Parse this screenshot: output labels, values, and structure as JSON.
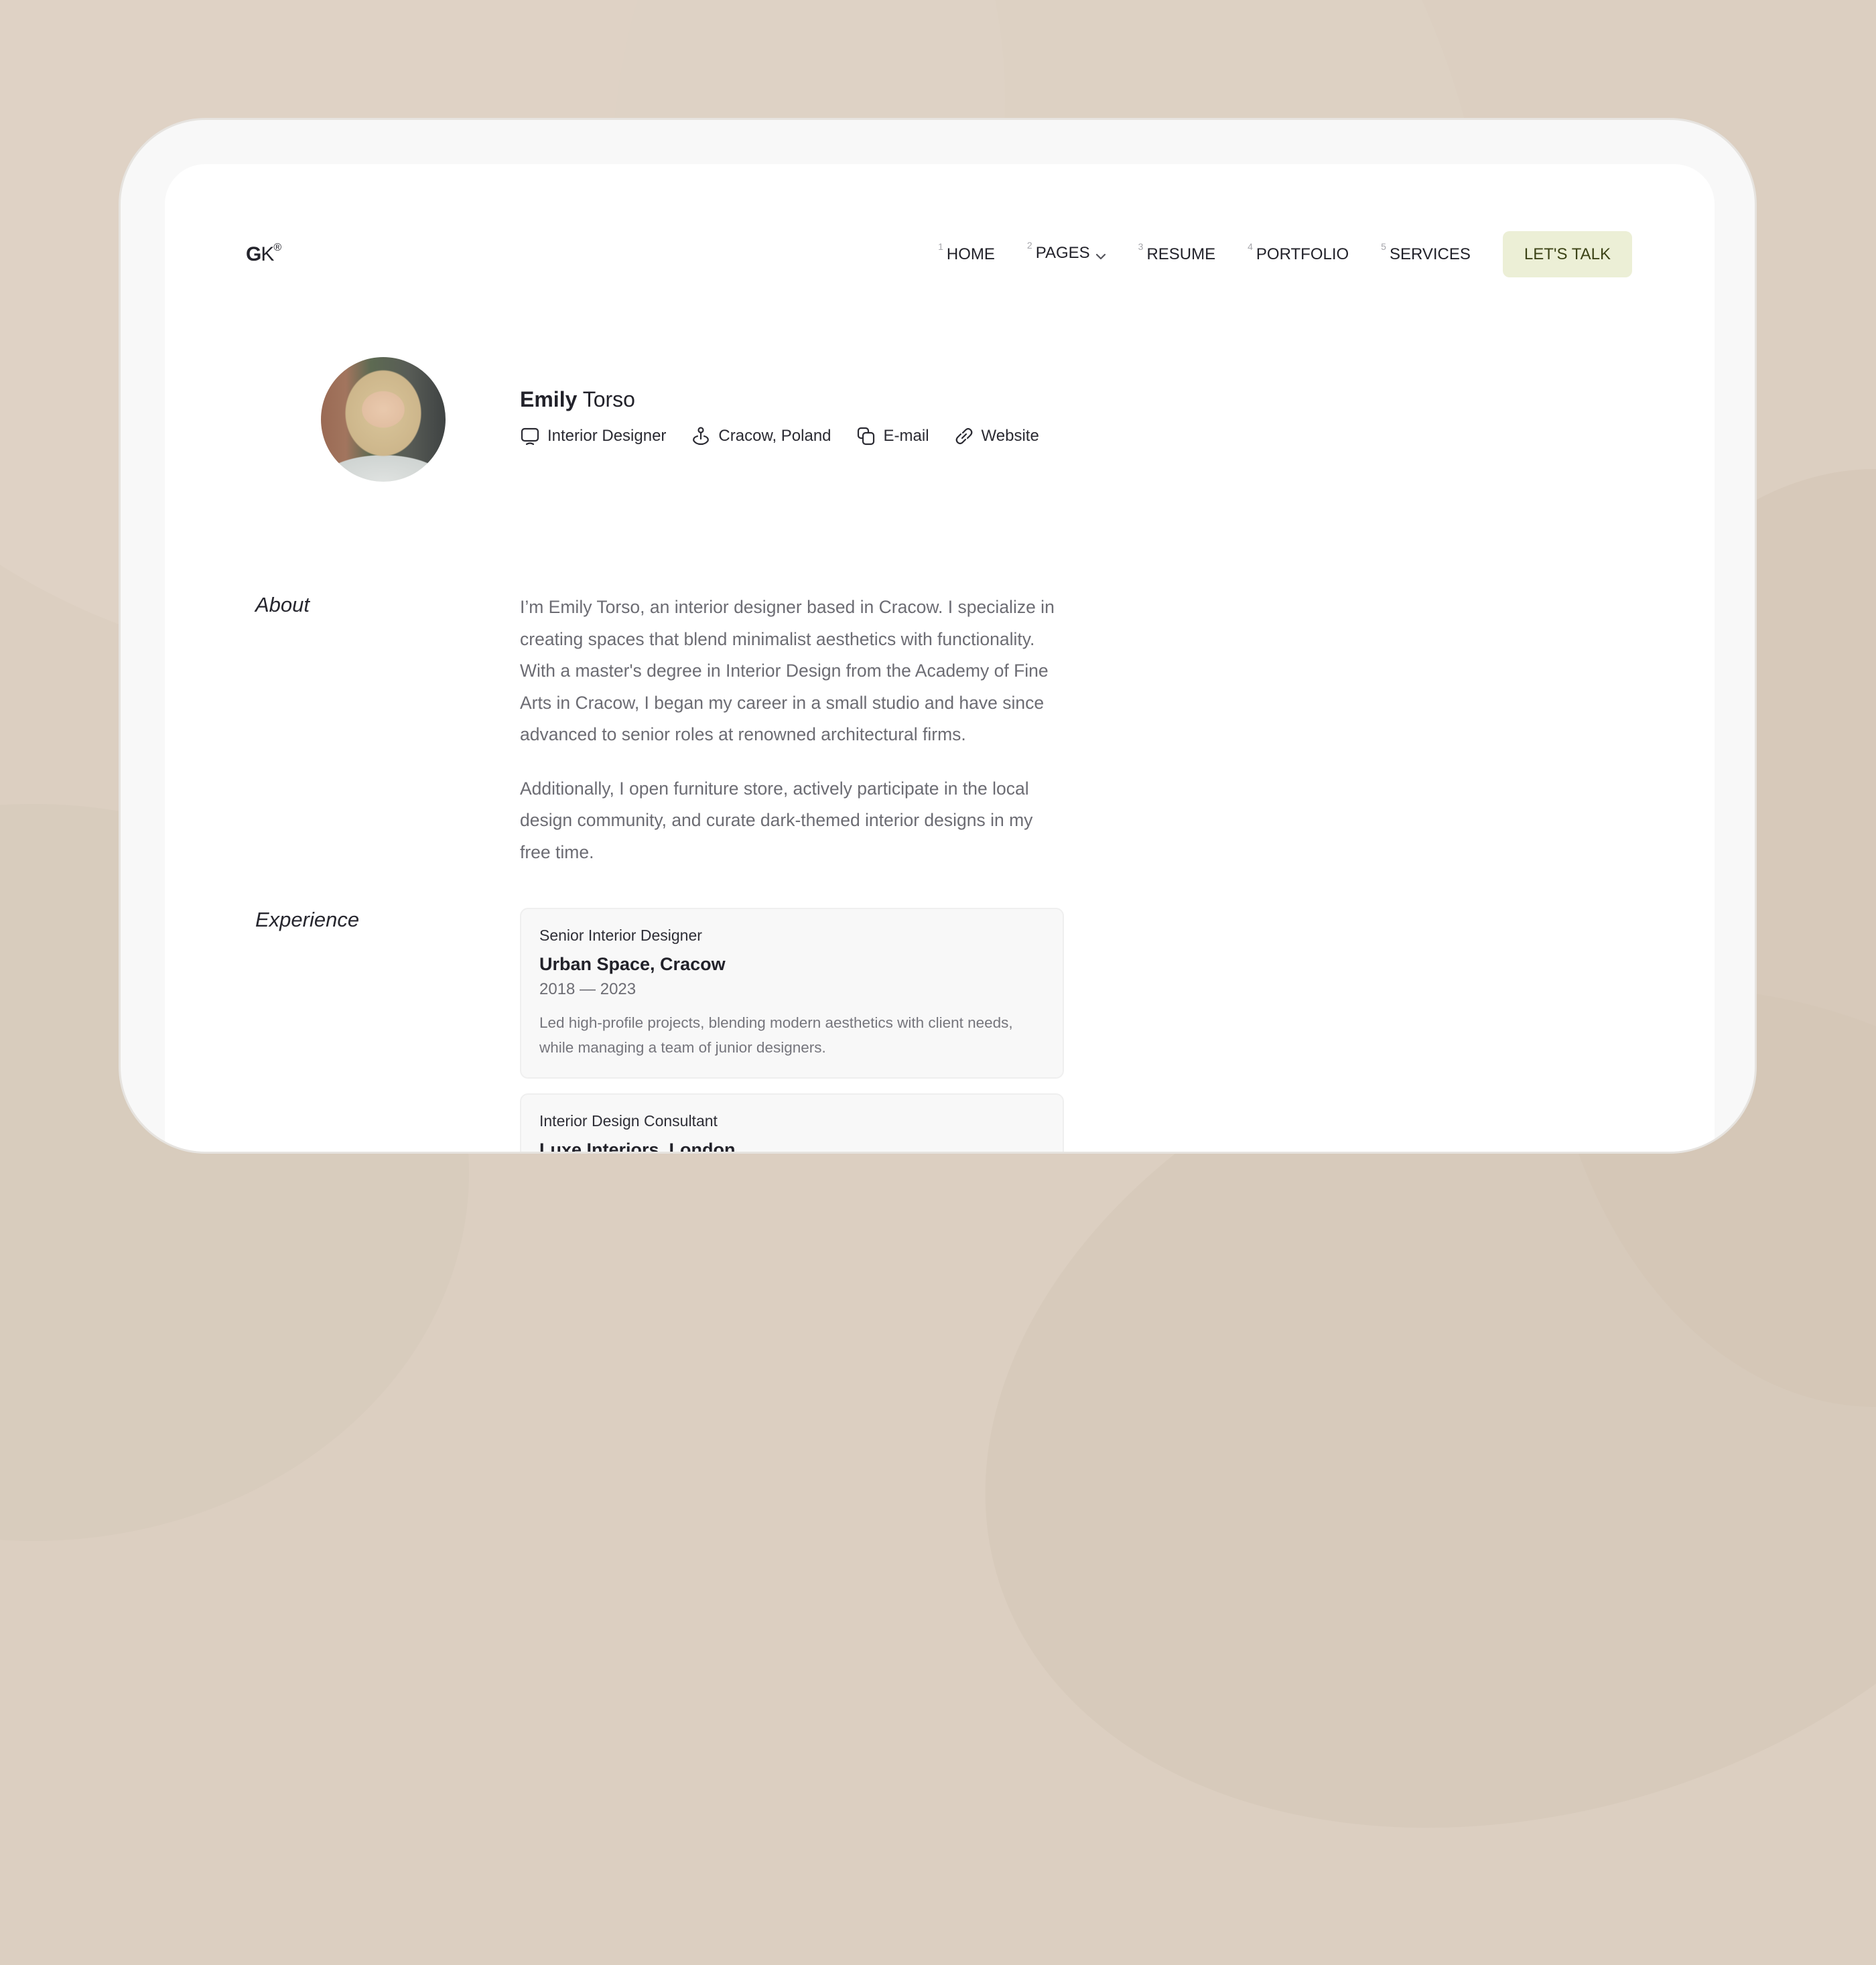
{
  "logo": {
    "text_bold": "G",
    "text_rest": "K",
    "mark": "®"
  },
  "nav": {
    "items": [
      {
        "num": "1",
        "label": "HOME"
      },
      {
        "num": "2",
        "label": "PAGES",
        "icon": "chevron-down-icon"
      },
      {
        "num": "3",
        "label": "RESUME"
      },
      {
        "num": "4",
        "label": "PORTFOLIO"
      },
      {
        "num": "5",
        "label": "SERVICES"
      }
    ],
    "cta_label": "LET'S TALK"
  },
  "profile": {
    "first_name": "Emily",
    "last_name": "Torso",
    "meta": [
      {
        "icon": "monitor-icon",
        "label": "Interior Designer"
      },
      {
        "icon": "location-pin-icon",
        "label": "Cracow, Poland"
      },
      {
        "icon": "copy-icon",
        "label": "E-mail"
      },
      {
        "icon": "link-icon",
        "label": "Website"
      }
    ]
  },
  "about": {
    "label": "About",
    "paragraphs": [
      "I’m Emily Torso, an interior designer based in Cracow. I specialize in creating spaces that blend minimalist aesthetics with functionality. With a master's degree in Interior Design from the Academy of Fine Arts in Cracow, I began my career in a small studio and have since advanced to senior roles at renowned architectural firms.",
      "Additionally, I open furniture store, actively participate in the local design community, and curate dark-themed interior designs in my free time."
    ]
  },
  "experience": {
    "label": "Experience",
    "items": [
      {
        "role": "Senior Interior Designer",
        "company": "Urban Space, Cracow",
        "period": "2018 — 2023",
        "description": "Led high-profile projects, blending modern aesthetics with client needs, while managing a team of junior designers."
      },
      {
        "role": "Interior Design Consultant",
        "company": "Luxe Interiors, London"
      }
    ]
  },
  "colors": {
    "background": "#dccfc1",
    "frame": "#f8f8f8",
    "page": "#ffffff",
    "cta_bg": "#ecefd6",
    "cta_text": "#3c4316",
    "text_dark": "#22222a",
    "text_muted": "#6c6c73"
  }
}
